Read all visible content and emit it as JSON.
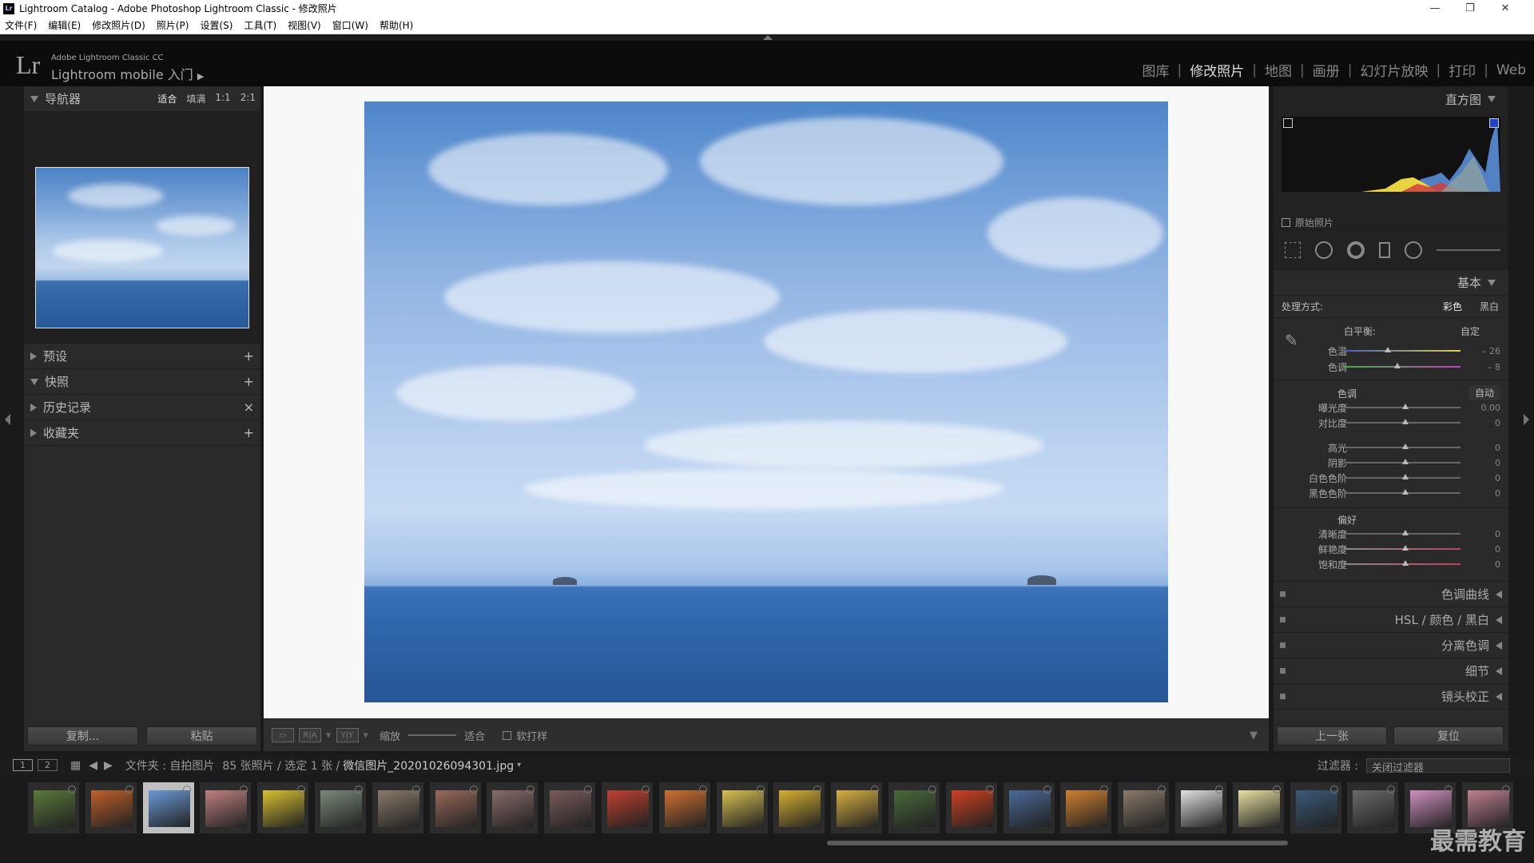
{
  "window": {
    "title": "Lightroom Catalog - Adobe Photoshop Lightroom Classic - 修改照片",
    "icon": "Lr"
  },
  "menu": [
    "文件(F)",
    "编辑(E)",
    "修改照片(D)",
    "照片(P)",
    "设置(S)",
    "工具(T)",
    "视图(V)",
    "窗口(W)",
    "帮助(H)"
  ],
  "header": {
    "logo": "Lr",
    "product": "Adobe Lightroom Classic CC",
    "mobile": "Lightroom mobile 入门",
    "modules": [
      "图库",
      "修改照片",
      "地图",
      "画册",
      "幻灯片放映",
      "打印",
      "Web"
    ],
    "active_module": "修改照片"
  },
  "left_panel": {
    "navigator": {
      "title": "导航器",
      "zoom": [
        "适合",
        "填满",
        "1:1",
        "2:1"
      ]
    },
    "sections": [
      {
        "title": "预设",
        "action": "+"
      },
      {
        "title": "快照",
        "action": "+"
      },
      {
        "title": "历史记录",
        "action": "×"
      },
      {
        "title": "收藏夹",
        "action": "+"
      }
    ],
    "buttons": {
      "copy": "复制...",
      "paste": "粘贴"
    }
  },
  "toolbar": {
    "zoom_label": "缩放",
    "zoom_value": "适合",
    "softproof": "软打样"
  },
  "right_panel": {
    "histogram": {
      "title": "直方图",
      "original": "原始照片"
    },
    "basic": {
      "title": "基本",
      "treatment_label": "处理方式:",
      "treatment_color": "彩色",
      "treatment_bw": "黑白",
      "wb_label": "白平衡:",
      "wb_value": "自定",
      "temp": {
        "label": "色温",
        "value": "– 26",
        "level": 0.38
      },
      "tint": {
        "label": "色调",
        "value": "– 8",
        "level": 0.46
      },
      "tone_label": "色调",
      "auto": "自动",
      "exposure": {
        "label": "曝光度",
        "value": "0.00"
      },
      "contrast": {
        "label": "对比度",
        "value": "0"
      },
      "highlights": {
        "label": "高光",
        "value": "0"
      },
      "shadows": {
        "label": "阴影",
        "value": "0"
      },
      "whites": {
        "label": "白色色阶",
        "value": "0"
      },
      "blacks": {
        "label": "黑色色阶",
        "value": "0"
      },
      "presence_label": "偏好",
      "clarity": {
        "label": "清晰度",
        "value": "0"
      },
      "vibrance": {
        "label": "鲜艳度",
        "value": "0"
      },
      "saturation": {
        "label": "饱和度",
        "value": "0"
      }
    },
    "collapsed": [
      "色调曲线",
      "HSL / 颜色 / 黑白",
      "分离色调",
      "细节",
      "镜头校正"
    ],
    "buttons": {
      "prev": "上一张",
      "reset": "复位"
    }
  },
  "filmbar": {
    "pages": [
      "1",
      "2"
    ],
    "source": "文件夹 : 自拍图片",
    "count": "85 张照片 / 选定 1 张 /",
    "filename": "微信图片_20201026094301.jpg",
    "filter_label": "过滤器 :",
    "filter_value": "关闭过滤器"
  },
  "watermark": "最需教育",
  "colors": {
    "accent": "#ddd",
    "panel": "#2a2a2a",
    "dark": "#0c0c0c"
  }
}
